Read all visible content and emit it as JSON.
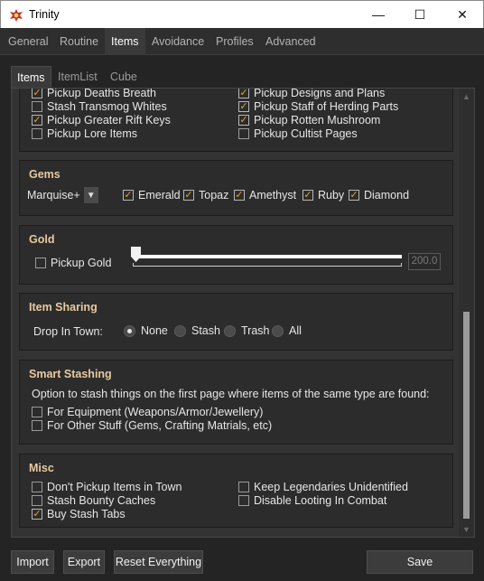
{
  "window": {
    "title": "Trinity",
    "minimize_glyph": "—",
    "maximize_glyph": "☐",
    "close_glyph": "✕"
  },
  "main_tabs": [
    {
      "label": "General"
    },
    {
      "label": "Routine"
    },
    {
      "label": "Items"
    },
    {
      "label": "Avoidance"
    },
    {
      "label": "Profiles"
    },
    {
      "label": "Advanced"
    }
  ],
  "sub_tabs": [
    {
      "label": "Items"
    },
    {
      "label": "ItemList"
    },
    {
      "label": "Cube"
    }
  ],
  "pickup": {
    "items": [
      {
        "label": "Pickup Deaths Breath",
        "checked": true
      },
      {
        "label": "Stash Transmog Whites",
        "checked": false
      },
      {
        "label": "Pickup Greater Rift Keys",
        "checked": true
      },
      {
        "label": "Pickup Lore Items",
        "checked": false
      },
      {
        "label": "Pickup Designs and Plans",
        "checked": true
      },
      {
        "label": "Pickup Staff of Herding Parts",
        "checked": true
      },
      {
        "label": "Pickup Rotten Mushroom",
        "checked": true
      },
      {
        "label": "Pickup Cultist Pages",
        "checked": false
      }
    ]
  },
  "gems": {
    "title": "Gems",
    "quality": "Marquise+",
    "types": [
      {
        "label": "Emerald",
        "checked": true
      },
      {
        "label": "Topaz",
        "checked": true
      },
      {
        "label": "Amethyst",
        "checked": true
      },
      {
        "label": "Ruby",
        "checked": true
      },
      {
        "label": "Diamond",
        "checked": true
      }
    ]
  },
  "gold": {
    "title": "Gold",
    "pickup_label": "Pickup Gold",
    "pickup_checked": false,
    "amount": "200.0",
    "slider_fraction": 0.0
  },
  "item_sharing": {
    "title": "Item Sharing",
    "label": "Drop In Town:",
    "options": [
      {
        "label": "None",
        "selected": true
      },
      {
        "label": "Stash",
        "selected": false
      },
      {
        "label": "Trash",
        "selected": false
      },
      {
        "label": "All",
        "selected": false
      }
    ]
  },
  "smart_stashing": {
    "title": "Smart Stashing",
    "description": "Option to stash things on the first page where items of the same type are found:",
    "options": [
      {
        "label": "For Equipment (Weapons/Armor/Jewellery)",
        "checked": false
      },
      {
        "label": "For Other Stuff (Gems, Crafting Matrials, etc)",
        "checked": false
      }
    ]
  },
  "misc": {
    "title": "Misc",
    "options": [
      {
        "label": "Don't Pickup Items in Town",
        "checked": false
      },
      {
        "label": "Stash Bounty Caches",
        "checked": false
      },
      {
        "label": "Buy Stash Tabs",
        "checked": true
      },
      {
        "label": "Keep Legendaries Unidentified",
        "checked": false
      },
      {
        "label": "Disable Looting In Combat",
        "checked": false
      }
    ]
  },
  "footer": {
    "import_label": "Import",
    "export_label": "Export",
    "reset_label": "Reset Everything",
    "save_label": "Save"
  },
  "colors": {
    "accent_orange": "#e8a22a",
    "group_title": "#e8c9a0",
    "background": "#242424"
  }
}
